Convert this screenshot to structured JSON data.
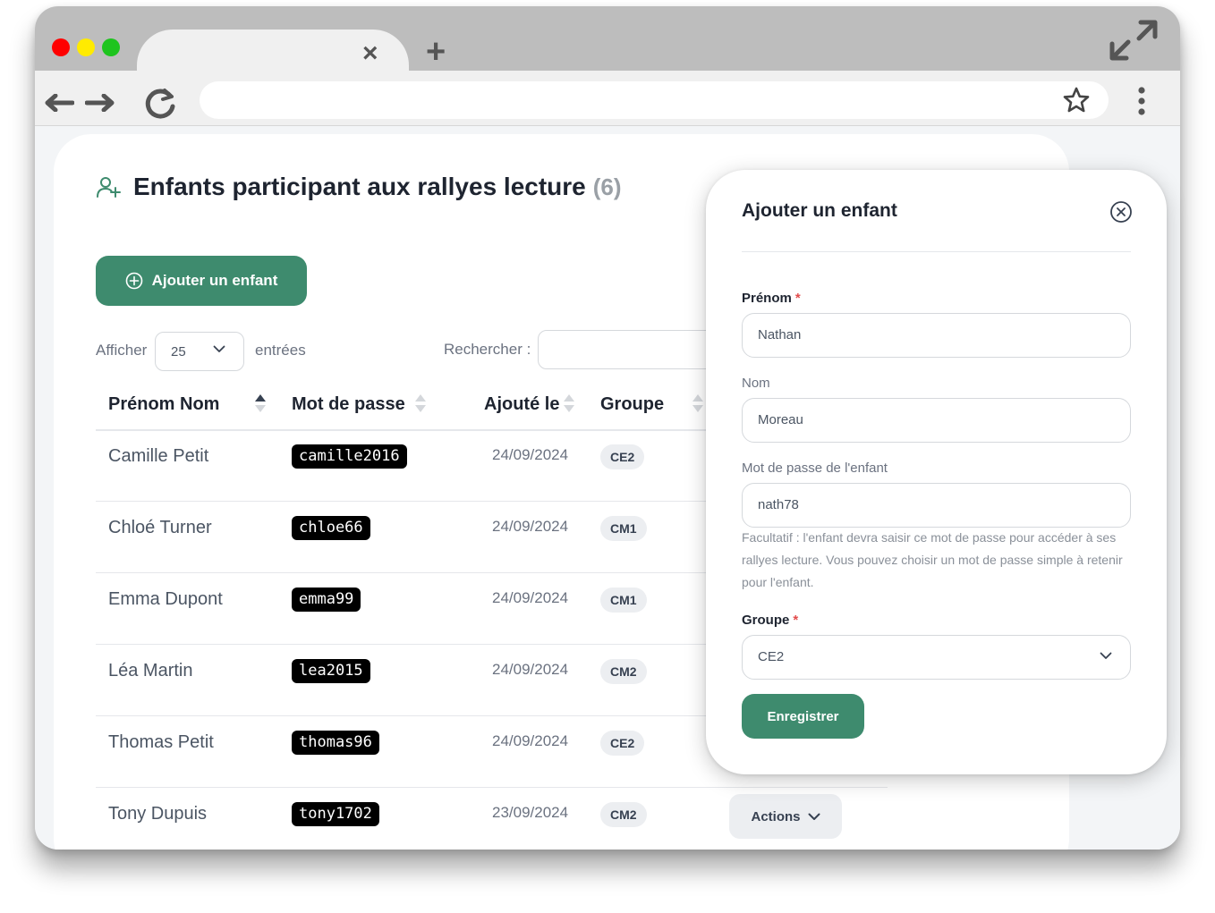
{
  "browser": {
    "tab_close": "×",
    "tab_new": "+",
    "colors": {
      "close": "#ff0000",
      "minimize": "#ffeb00",
      "maximize": "#1ec41e"
    }
  },
  "page": {
    "title": "Enfants participant aux rallyes lecture",
    "count": "(6)",
    "add_button": "Ajouter un enfant",
    "show_label": "Afficher",
    "page_size": "25",
    "entries_label": "entrées",
    "search_label": "Rechercher :",
    "search_value": "",
    "accent_color": "#3e8b6e"
  },
  "table": {
    "columns": [
      "Prénom Nom",
      "Mot de passe",
      "Ajouté le",
      "Groupe"
    ],
    "rows": [
      {
        "name": "Camille Petit",
        "password": "camille2016",
        "date": "24/09/2024",
        "group": "CE2"
      },
      {
        "name": "Chloé Turner",
        "password": "chloe66",
        "date": "24/09/2024",
        "group": "CM1"
      },
      {
        "name": "Emma Dupont",
        "password": "emma99",
        "date": "24/09/2024",
        "group": "CM1"
      },
      {
        "name": "Léa Martin",
        "password": "lea2015",
        "date": "24/09/2024",
        "group": "CM2"
      },
      {
        "name": "Thomas Petit",
        "password": "thomas96",
        "date": "24/09/2024",
        "group": "CE2"
      },
      {
        "name": "Tony Dupuis",
        "password": "tony1702",
        "date": "23/09/2024",
        "group": "CM2"
      }
    ],
    "actions_label": "Actions"
  },
  "modal": {
    "title": "Ajouter un enfant",
    "first_name_label": "Prénom",
    "first_name_value": "Nathan",
    "last_name_label": "Nom",
    "last_name_value": "Moreau",
    "password_label": "Mot de passe de l'enfant",
    "password_value": "nath78",
    "password_help": "Facultatif : l'enfant devra saisir ce mot de passe pour accéder à ses rallyes lecture. Vous pouvez choisir un mot de passe simple à retenir pour l'enfant.",
    "group_label": "Groupe",
    "group_value": "CE2",
    "required_mark": "*",
    "save_button": "Enregistrer"
  }
}
